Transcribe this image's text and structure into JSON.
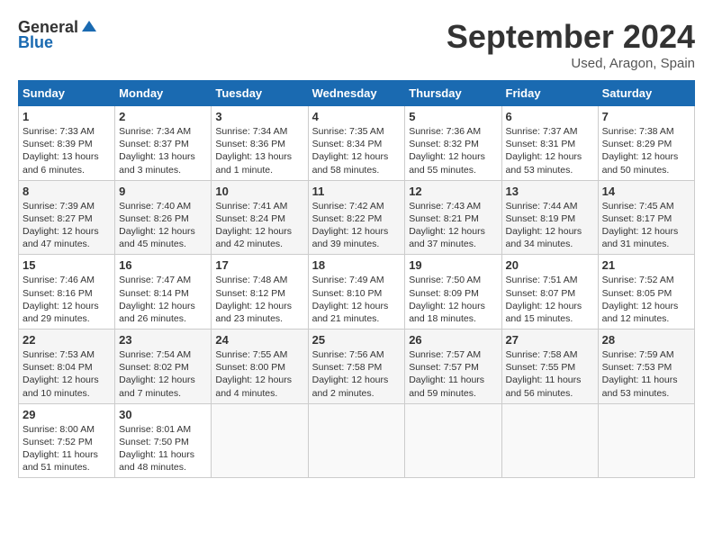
{
  "header": {
    "logo_general": "General",
    "logo_blue": "Blue",
    "title": "September 2024",
    "location": "Used, Aragon, Spain"
  },
  "days_of_week": [
    "Sunday",
    "Monday",
    "Tuesday",
    "Wednesday",
    "Thursday",
    "Friday",
    "Saturday"
  ],
  "weeks": [
    [
      {
        "day": "1",
        "info": "Sunrise: 7:33 AM\nSunset: 8:39 PM\nDaylight: 13 hours and 6 minutes."
      },
      {
        "day": "2",
        "info": "Sunrise: 7:34 AM\nSunset: 8:37 PM\nDaylight: 13 hours and 3 minutes."
      },
      {
        "day": "3",
        "info": "Sunrise: 7:34 AM\nSunset: 8:36 PM\nDaylight: 13 hours and 1 minute."
      },
      {
        "day": "4",
        "info": "Sunrise: 7:35 AM\nSunset: 8:34 PM\nDaylight: 12 hours and 58 minutes."
      },
      {
        "day": "5",
        "info": "Sunrise: 7:36 AM\nSunset: 8:32 PM\nDaylight: 12 hours and 55 minutes."
      },
      {
        "day": "6",
        "info": "Sunrise: 7:37 AM\nSunset: 8:31 PM\nDaylight: 12 hours and 53 minutes."
      },
      {
        "day": "7",
        "info": "Sunrise: 7:38 AM\nSunset: 8:29 PM\nDaylight: 12 hours and 50 minutes."
      }
    ],
    [
      {
        "day": "8",
        "info": "Sunrise: 7:39 AM\nSunset: 8:27 PM\nDaylight: 12 hours and 47 minutes."
      },
      {
        "day": "9",
        "info": "Sunrise: 7:40 AM\nSunset: 8:26 PM\nDaylight: 12 hours and 45 minutes."
      },
      {
        "day": "10",
        "info": "Sunrise: 7:41 AM\nSunset: 8:24 PM\nDaylight: 12 hours and 42 minutes."
      },
      {
        "day": "11",
        "info": "Sunrise: 7:42 AM\nSunset: 8:22 PM\nDaylight: 12 hours and 39 minutes."
      },
      {
        "day": "12",
        "info": "Sunrise: 7:43 AM\nSunset: 8:21 PM\nDaylight: 12 hours and 37 minutes."
      },
      {
        "day": "13",
        "info": "Sunrise: 7:44 AM\nSunset: 8:19 PM\nDaylight: 12 hours and 34 minutes."
      },
      {
        "day": "14",
        "info": "Sunrise: 7:45 AM\nSunset: 8:17 PM\nDaylight: 12 hours and 31 minutes."
      }
    ],
    [
      {
        "day": "15",
        "info": "Sunrise: 7:46 AM\nSunset: 8:16 PM\nDaylight: 12 hours and 29 minutes."
      },
      {
        "day": "16",
        "info": "Sunrise: 7:47 AM\nSunset: 8:14 PM\nDaylight: 12 hours and 26 minutes."
      },
      {
        "day": "17",
        "info": "Sunrise: 7:48 AM\nSunset: 8:12 PM\nDaylight: 12 hours and 23 minutes."
      },
      {
        "day": "18",
        "info": "Sunrise: 7:49 AM\nSunset: 8:10 PM\nDaylight: 12 hours and 21 minutes."
      },
      {
        "day": "19",
        "info": "Sunrise: 7:50 AM\nSunset: 8:09 PM\nDaylight: 12 hours and 18 minutes."
      },
      {
        "day": "20",
        "info": "Sunrise: 7:51 AM\nSunset: 8:07 PM\nDaylight: 12 hours and 15 minutes."
      },
      {
        "day": "21",
        "info": "Sunrise: 7:52 AM\nSunset: 8:05 PM\nDaylight: 12 hours and 12 minutes."
      }
    ],
    [
      {
        "day": "22",
        "info": "Sunrise: 7:53 AM\nSunset: 8:04 PM\nDaylight: 12 hours and 10 minutes."
      },
      {
        "day": "23",
        "info": "Sunrise: 7:54 AM\nSunset: 8:02 PM\nDaylight: 12 hours and 7 minutes."
      },
      {
        "day": "24",
        "info": "Sunrise: 7:55 AM\nSunset: 8:00 PM\nDaylight: 12 hours and 4 minutes."
      },
      {
        "day": "25",
        "info": "Sunrise: 7:56 AM\nSunset: 7:58 PM\nDaylight: 12 hours and 2 minutes."
      },
      {
        "day": "26",
        "info": "Sunrise: 7:57 AM\nSunset: 7:57 PM\nDaylight: 11 hours and 59 minutes."
      },
      {
        "day": "27",
        "info": "Sunrise: 7:58 AM\nSunset: 7:55 PM\nDaylight: 11 hours and 56 minutes."
      },
      {
        "day": "28",
        "info": "Sunrise: 7:59 AM\nSunset: 7:53 PM\nDaylight: 11 hours and 53 minutes."
      }
    ],
    [
      {
        "day": "29",
        "info": "Sunrise: 8:00 AM\nSunset: 7:52 PM\nDaylight: 11 hours and 51 minutes."
      },
      {
        "day": "30",
        "info": "Sunrise: 8:01 AM\nSunset: 7:50 PM\nDaylight: 11 hours and 48 minutes."
      },
      {
        "day": "",
        "info": ""
      },
      {
        "day": "",
        "info": ""
      },
      {
        "day": "",
        "info": ""
      },
      {
        "day": "",
        "info": ""
      },
      {
        "day": "",
        "info": ""
      }
    ]
  ]
}
